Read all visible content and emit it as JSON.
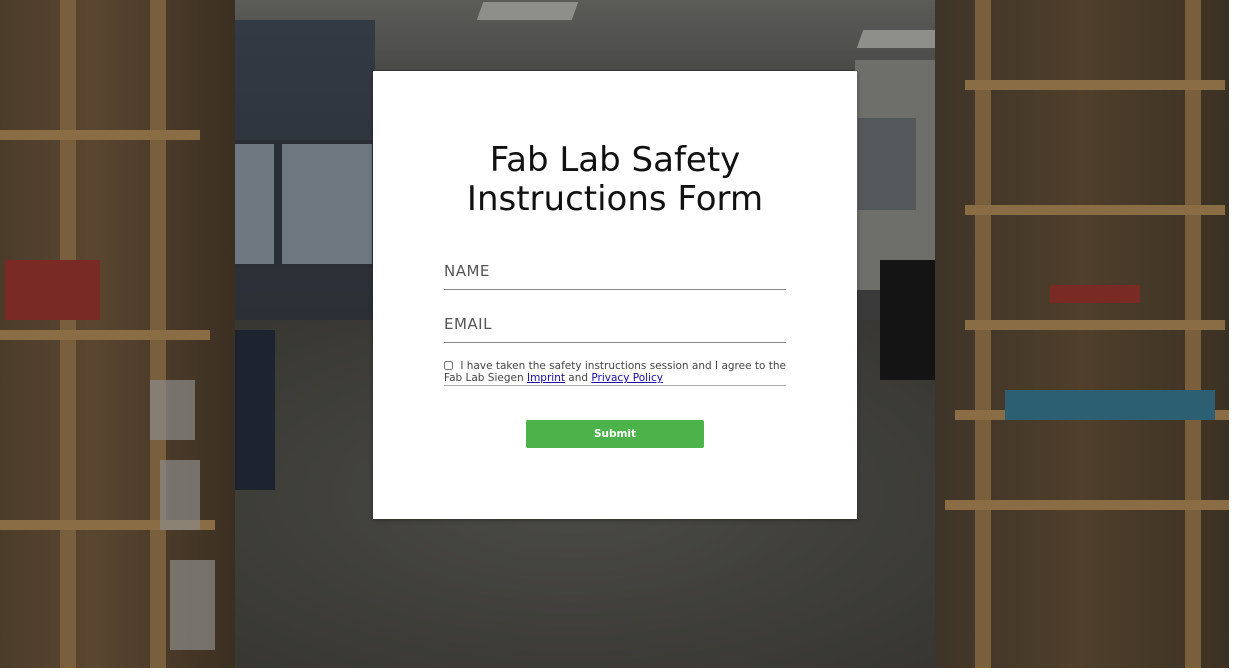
{
  "form": {
    "title_line1": "Fab Lab Safety",
    "title_line2": "Instructions Form",
    "name_placeholder": "NAME",
    "email_placeholder": "EMAIL",
    "consent_text_before": "I have taken the safety instructions session and I agree to the Fab Lab Siegen ",
    "imprint_link": "Imprint",
    "consent_text_mid": " and ",
    "privacy_link": "Privacy Policy",
    "consent_checked": false,
    "submit_label": "Submit"
  },
  "colors": {
    "submit_bg": "#4cb34a",
    "link": "#1a0dab",
    "card_bg": "#ffffff"
  }
}
